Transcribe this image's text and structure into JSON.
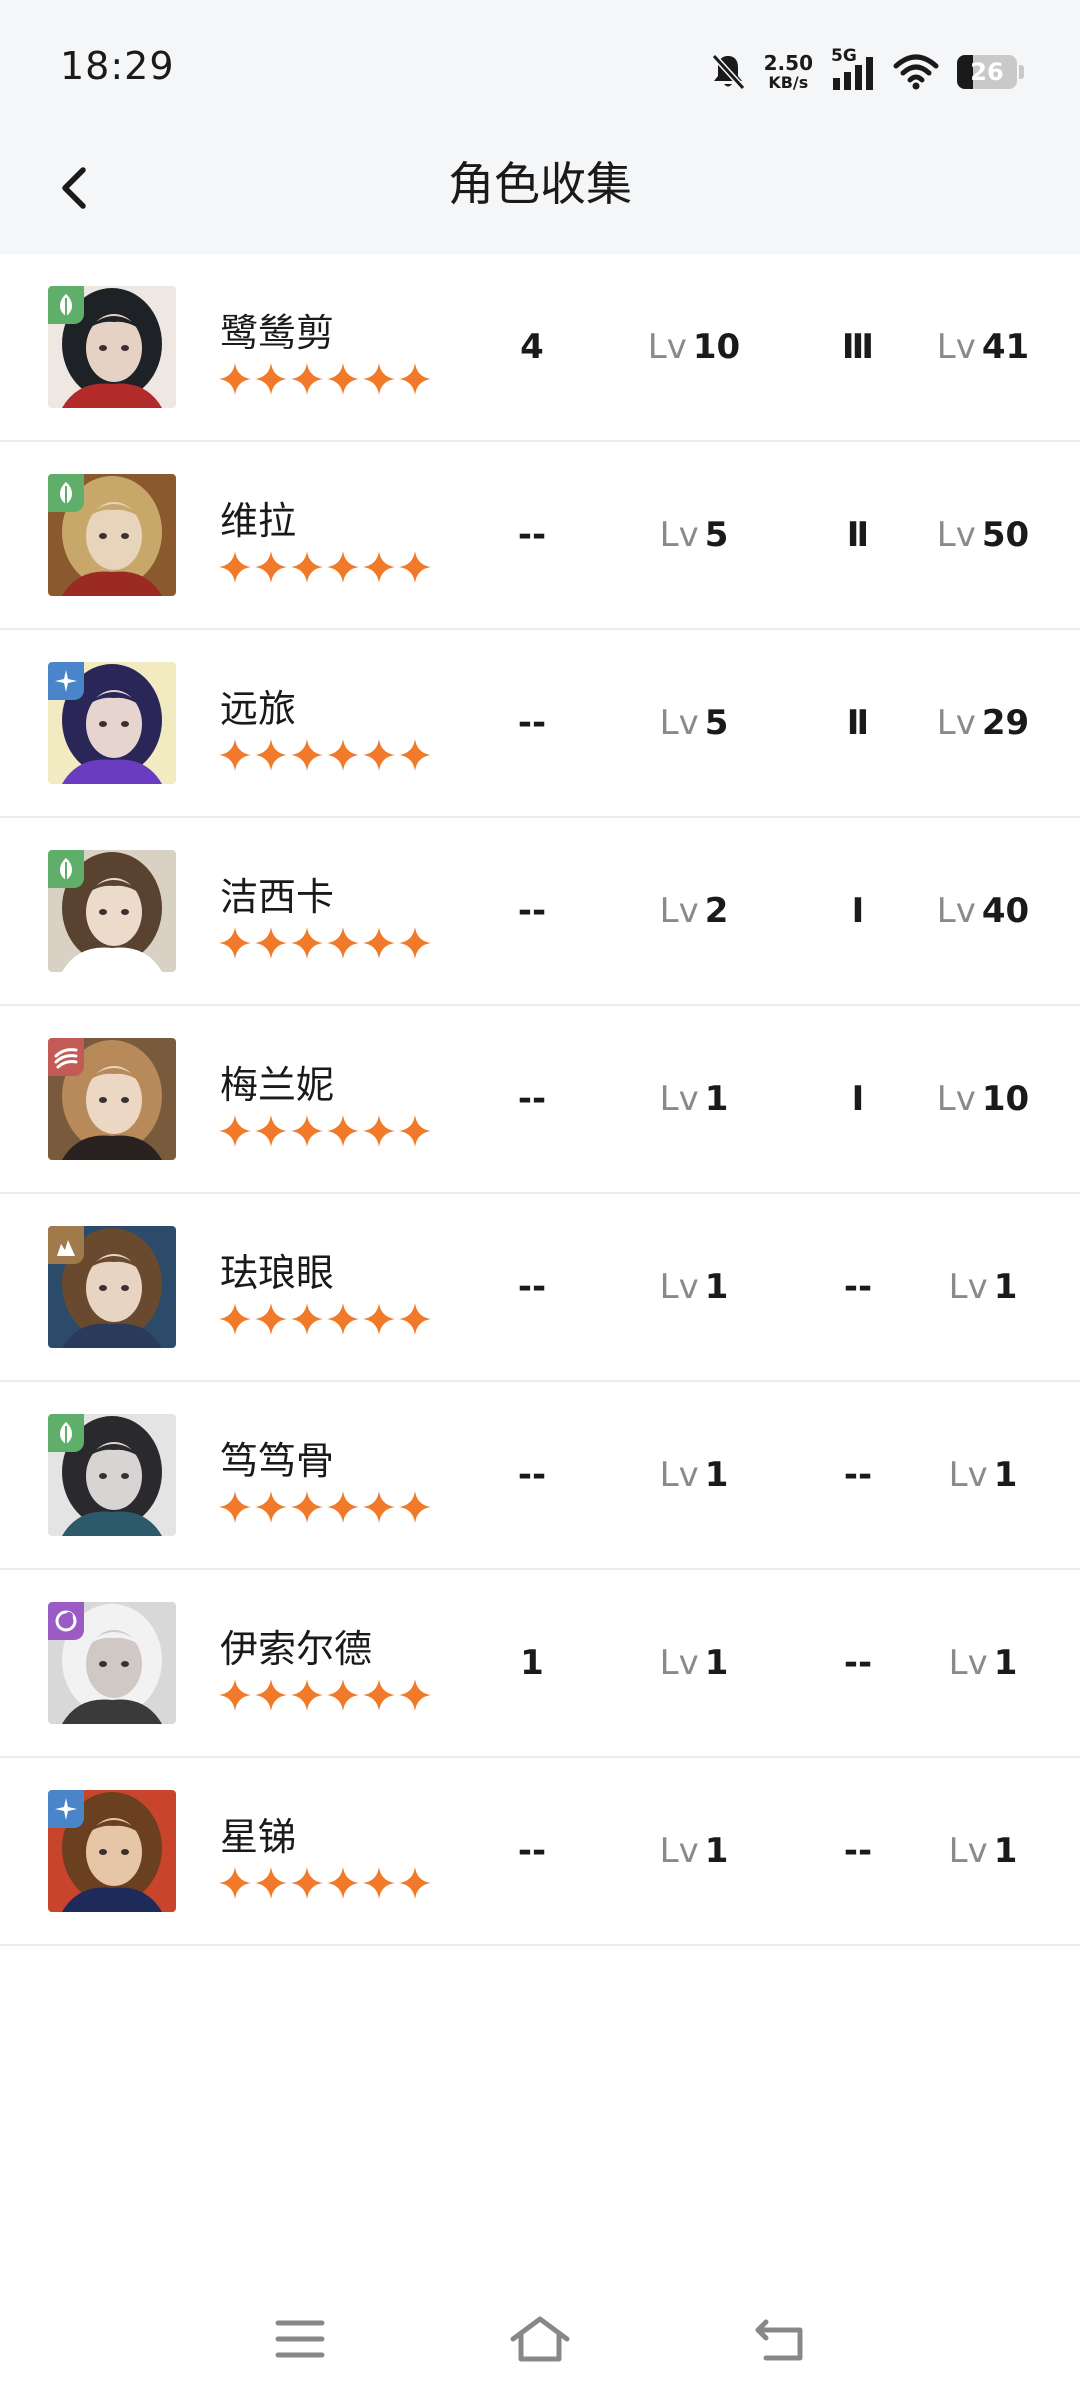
{
  "status_bar": {
    "time": "18:29",
    "net_speed_value": "2.50",
    "net_speed_unit": "KB/s",
    "network": "5G",
    "battery_level": "26"
  },
  "header": {
    "title": "角色收集"
  },
  "lv_label": "Lv",
  "characters": [
    {
      "name": "鹭鸶剪",
      "stars": 6,
      "count": "4",
      "level": "10",
      "tier": "Ⅲ",
      "weapon_level": "41",
      "attribute": "leaf-icon",
      "badge_color": "#5fae6a"
    },
    {
      "name": "维拉",
      "stars": 6,
      "count": "--",
      "level": "5",
      "tier": "Ⅱ",
      "weapon_level": "50",
      "attribute": "leaf-icon",
      "badge_color": "#5fae6a"
    },
    {
      "name": "远旅",
      "stars": 6,
      "count": "--",
      "level": "5",
      "tier": "Ⅱ",
      "weapon_level": "29",
      "attribute": "star-icon",
      "badge_color": "#4a84c9"
    },
    {
      "name": "洁西卡",
      "stars": 6,
      "count": "--",
      "level": "2",
      "tier": "Ⅰ",
      "weapon_level": "40",
      "attribute": "leaf-icon",
      "badge_color": "#5fae6a"
    },
    {
      "name": "梅兰妮",
      "stars": 6,
      "count": "--",
      "level": "1",
      "tier": "Ⅰ",
      "weapon_level": "10",
      "attribute": "wave-icon",
      "badge_color": "#c25b55"
    },
    {
      "name": "珐琅眼",
      "stars": 6,
      "count": "--",
      "level": "1",
      "tier": "--",
      "weapon_level": "1",
      "attribute": "stone-icon",
      "badge_color": "#a07a4a"
    },
    {
      "name": "笃笃骨",
      "stars": 6,
      "count": "--",
      "level": "1",
      "tier": "--",
      "weapon_level": "1",
      "attribute": "leaf-icon",
      "badge_color": "#5fae6a"
    },
    {
      "name": "伊索尔德",
      "stars": 6,
      "count": "1",
      "level": "1",
      "tier": "--",
      "weapon_level": "1",
      "attribute": "moon-icon",
      "badge_color": "#9a5cc4"
    },
    {
      "name": "星锑",
      "stars": 6,
      "count": "--",
      "level": "1",
      "tier": "--",
      "weapon_level": "1",
      "attribute": "star-icon",
      "badge_color": "#4a84c9"
    }
  ],
  "colors": {
    "star": "#f0792a",
    "background": "#f5f6f8"
  }
}
